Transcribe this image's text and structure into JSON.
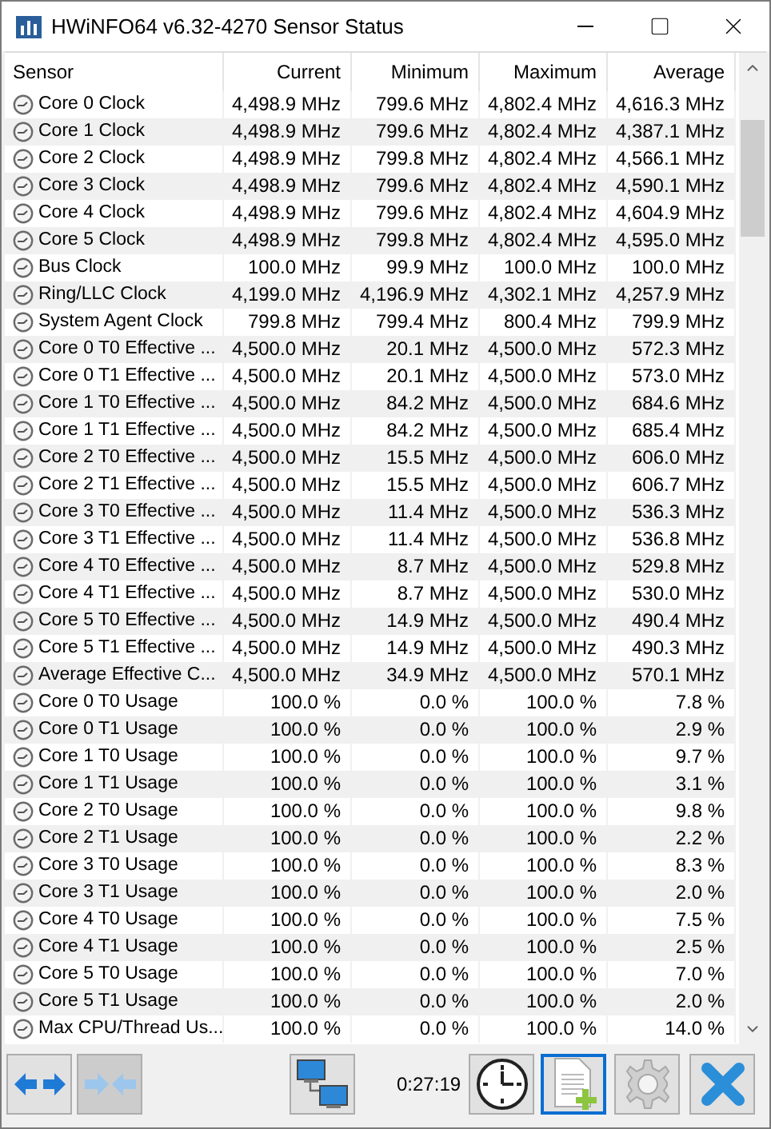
{
  "window": {
    "title": "HWiNFO64 v6.32-4270 Sensor Status"
  },
  "table": {
    "columns": [
      "Sensor",
      "Current",
      "Minimum",
      "Maximum",
      "Average"
    ],
    "rows": [
      [
        "Core 0 Clock",
        "4,498.9 MHz",
        "799.6 MHz",
        "4,802.4 MHz",
        "4,616.3 MHz"
      ],
      [
        "Core 1 Clock",
        "4,498.9 MHz",
        "799.6 MHz",
        "4,802.4 MHz",
        "4,387.1 MHz"
      ],
      [
        "Core 2 Clock",
        "4,498.9 MHz",
        "799.8 MHz",
        "4,802.4 MHz",
        "4,566.1 MHz"
      ],
      [
        "Core 3 Clock",
        "4,498.9 MHz",
        "799.6 MHz",
        "4,802.4 MHz",
        "4,590.1 MHz"
      ],
      [
        "Core 4 Clock",
        "4,498.9 MHz",
        "799.6 MHz",
        "4,802.4 MHz",
        "4,604.9 MHz"
      ],
      [
        "Core 5 Clock",
        "4,498.9 MHz",
        "799.8 MHz",
        "4,802.4 MHz",
        "4,595.0 MHz"
      ],
      [
        "Bus Clock",
        "100.0 MHz",
        "99.9 MHz",
        "100.0 MHz",
        "100.0 MHz"
      ],
      [
        "Ring/LLC Clock",
        "4,199.0 MHz",
        "4,196.9 MHz",
        "4,302.1 MHz",
        "4,257.9 MHz"
      ],
      [
        "System Agent Clock",
        "799.8 MHz",
        "799.4 MHz",
        "800.4 MHz",
        "799.9 MHz"
      ],
      [
        "Core 0 T0 Effective ...",
        "4,500.0 MHz",
        "20.1 MHz",
        "4,500.0 MHz",
        "572.3 MHz"
      ],
      [
        "Core 0 T1 Effective ...",
        "4,500.0 MHz",
        "20.1 MHz",
        "4,500.0 MHz",
        "573.0 MHz"
      ],
      [
        "Core 1 T0 Effective ...",
        "4,500.0 MHz",
        "84.2 MHz",
        "4,500.0 MHz",
        "684.6 MHz"
      ],
      [
        "Core 1 T1 Effective ...",
        "4,500.0 MHz",
        "84.2 MHz",
        "4,500.0 MHz",
        "685.4 MHz"
      ],
      [
        "Core 2 T0 Effective ...",
        "4,500.0 MHz",
        "15.5 MHz",
        "4,500.0 MHz",
        "606.0 MHz"
      ],
      [
        "Core 2 T1 Effective ...",
        "4,500.0 MHz",
        "15.5 MHz",
        "4,500.0 MHz",
        "606.7 MHz"
      ],
      [
        "Core 3 T0 Effective ...",
        "4,500.0 MHz",
        "11.4 MHz",
        "4,500.0 MHz",
        "536.3 MHz"
      ],
      [
        "Core 3 T1 Effective ...",
        "4,500.0 MHz",
        "11.4 MHz",
        "4,500.0 MHz",
        "536.8 MHz"
      ],
      [
        "Core 4 T0 Effective ...",
        "4,500.0 MHz",
        "8.7 MHz",
        "4,500.0 MHz",
        "529.8 MHz"
      ],
      [
        "Core 4 T1 Effective ...",
        "4,500.0 MHz",
        "8.7 MHz",
        "4,500.0 MHz",
        "530.0 MHz"
      ],
      [
        "Core 5 T0 Effective ...",
        "4,500.0 MHz",
        "14.9 MHz",
        "4,500.0 MHz",
        "490.4 MHz"
      ],
      [
        "Core 5 T1 Effective ...",
        "4,500.0 MHz",
        "14.9 MHz",
        "4,500.0 MHz",
        "490.3 MHz"
      ],
      [
        "Average Effective C...",
        "4,500.0 MHz",
        "34.9 MHz",
        "4,500.0 MHz",
        "570.1 MHz"
      ],
      [
        "Core 0 T0 Usage",
        "100.0 %",
        "0.0 %",
        "100.0 %",
        "7.8 %"
      ],
      [
        "Core 0 T1 Usage",
        "100.0 %",
        "0.0 %",
        "100.0 %",
        "2.9 %"
      ],
      [
        "Core 1 T0 Usage",
        "100.0 %",
        "0.0 %",
        "100.0 %",
        "9.7 %"
      ],
      [
        "Core 1 T1 Usage",
        "100.0 %",
        "0.0 %",
        "100.0 %",
        "3.1 %"
      ],
      [
        "Core 2 T0 Usage",
        "100.0 %",
        "0.0 %",
        "100.0 %",
        "9.8 %"
      ],
      [
        "Core 2 T1 Usage",
        "100.0 %",
        "0.0 %",
        "100.0 %",
        "2.2 %"
      ],
      [
        "Core 3 T0 Usage",
        "100.0 %",
        "0.0 %",
        "100.0 %",
        "8.3 %"
      ],
      [
        "Core 3 T1 Usage",
        "100.0 %",
        "0.0 %",
        "100.0 %",
        "2.0 %"
      ],
      [
        "Core 4 T0 Usage",
        "100.0 %",
        "0.0 %",
        "100.0 %",
        "7.5 %"
      ],
      [
        "Core 4 T1 Usage",
        "100.0 %",
        "0.0 %",
        "100.0 %",
        "2.5 %"
      ],
      [
        "Core 5 T0 Usage",
        "100.0 %",
        "0.0 %",
        "100.0 %",
        "7.0 %"
      ],
      [
        "Core 5 T1 Usage",
        "100.0 %",
        "0.0 %",
        "100.0 %",
        "2.0 %"
      ],
      [
        "Max CPU/Thread Us...",
        "100.0 %",
        "0.0 %",
        "100.0 %",
        "14.0 %"
      ]
    ]
  },
  "toolbar": {
    "items": [
      {
        "kind": "expand",
        "disabled": false,
        "focused": false
      },
      {
        "kind": "collapse",
        "disabled": true,
        "focused": false
      },
      {
        "kind": "network",
        "disabled": false,
        "focused": false
      },
      {
        "kind": "time",
        "text": "0:27:19"
      },
      {
        "kind": "clock",
        "disabled": false,
        "focused": false
      },
      {
        "kind": "log",
        "disabled": false,
        "focused": true
      },
      {
        "kind": "settings",
        "disabled": false,
        "focused": false
      },
      {
        "kind": "close",
        "disabled": false,
        "focused": false
      }
    ]
  }
}
